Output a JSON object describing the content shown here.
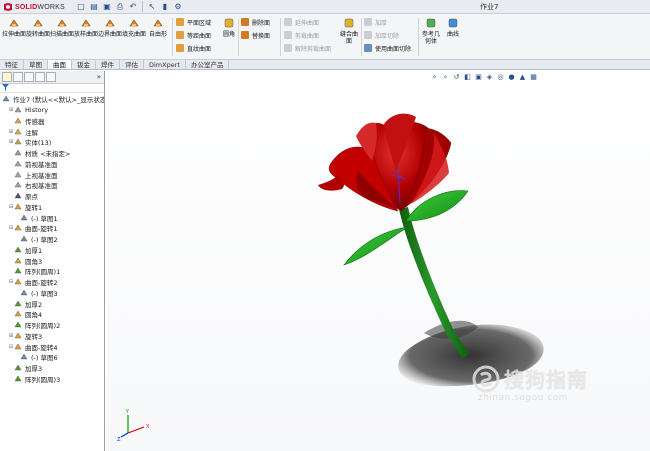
{
  "titlebar": {
    "brand_ds": "3S",
    "brand_name": "SOLID",
    "brand_name2": "WORKS",
    "document_title": "作业7"
  },
  "quick_access": [
    "new-icon",
    "open-icon",
    "save-icon",
    "print-icon",
    "undo-icon",
    "select-icon",
    "rebuild-icon",
    "options-icon"
  ],
  "ribbon": {
    "big_tools": [
      {
        "label": "拉伸曲面",
        "icon": "extrude-surface-icon",
        "color": "#d9822b"
      },
      {
        "label": "旋转曲面",
        "icon": "revolve-surface-icon",
        "color": "#d9822b"
      },
      {
        "label": "扫描曲面",
        "icon": "sweep-surface-icon",
        "color": "#d9822b"
      },
      {
        "label": "放样曲面",
        "icon": "loft-surface-icon",
        "color": "#d9822b"
      },
      {
        "label": "边界曲面",
        "icon": "boundary-surface-icon",
        "color": "#d9822b"
      },
      {
        "label": "填充曲面",
        "icon": "fill-surface-icon",
        "color": "#d9822b"
      },
      {
        "label": "自由形",
        "icon": "freeform-icon",
        "color": "#d9822b"
      }
    ],
    "col1": [
      {
        "label": "平面区域",
        "icon": "planar-surface-icon",
        "disabled": false
      },
      {
        "label": "等距曲面",
        "icon": "offset-surface-icon",
        "disabled": false
      },
      {
        "label": "直纹曲面",
        "icon": "ruled-surface-icon",
        "disabled": false
      }
    ],
    "fillet": {
      "label": "圆角",
      "icon": "fillet-icon"
    },
    "col2": [
      {
        "label": "删除面",
        "icon": "delete-face-icon",
        "disabled": false
      },
      {
        "label": "替换面",
        "icon": "replace-face-icon",
        "disabled": false
      }
    ],
    "col3": [
      {
        "label": "延伸曲面",
        "icon": "extend-surface-icon",
        "disabled": true
      },
      {
        "label": "剪裁曲面",
        "icon": "trim-surface-icon",
        "disabled": true
      },
      {
        "label": "解除剪裁曲面",
        "icon": "untrim-surface-icon",
        "disabled": true
      }
    ],
    "knit": {
      "label": "缝合曲面",
      "icon": "knit-surface-icon"
    },
    "col4": [
      {
        "label": "加厚",
        "icon": "thicken-icon",
        "disabled": true
      },
      {
        "label": "加厚切除",
        "icon": "thicken-cut-icon",
        "disabled": true
      },
      {
        "label": "使用曲面切除",
        "icon": "surface-cut-icon",
        "disabled": false
      }
    ],
    "ref_geometry": {
      "label": "参考几何体",
      "icon": "reference-geometry-icon"
    },
    "curves": {
      "label": "曲线",
      "icon": "curves-icon"
    }
  },
  "tabs": [
    {
      "label": "特征",
      "active": false
    },
    {
      "label": "草图",
      "active": false
    },
    {
      "label": "曲面",
      "active": true
    },
    {
      "label": "钣金",
      "active": false
    },
    {
      "label": "焊件",
      "active": false
    },
    {
      "label": "评估",
      "active": false
    },
    {
      "label": "DimXpert",
      "active": false
    },
    {
      "label": "办公室产品",
      "active": false
    }
  ],
  "feature_manager": {
    "collapse_label": "»",
    "filter_icon": "filter-icon",
    "tree": [
      {
        "label": "作业7 (默认<<默认>_显示状态",
        "indent": 0,
        "icon": "part-icon",
        "color": "#6f8fb8",
        "expand": ""
      },
      {
        "label": "History",
        "indent": 1,
        "icon": "history-icon",
        "color": "#a0a0a0",
        "expand": "+"
      },
      {
        "label": "传感器",
        "indent": 1,
        "icon": "sensor-icon",
        "color": "#d8b04a",
        "expand": ""
      },
      {
        "label": "注解",
        "indent": 1,
        "icon": "annotation-icon",
        "color": "#d8b04a",
        "expand": "+"
      },
      {
        "label": "实体(13)",
        "indent": 1,
        "icon": "solid-bodies-icon",
        "color": "#c9a14a",
        "expand": "+"
      },
      {
        "label": "材质 <未指定>",
        "indent": 1,
        "icon": "material-icon",
        "color": "#8ca0b4",
        "expand": ""
      },
      {
        "label": "前视基准面",
        "indent": 1,
        "icon": "plane-icon",
        "color": "#9aa7b5",
        "expand": ""
      },
      {
        "label": "上视基准面",
        "indent": 1,
        "icon": "plane-icon",
        "color": "#9aa7b5",
        "expand": ""
      },
      {
        "label": "右视基准面",
        "indent": 1,
        "icon": "plane-icon",
        "color": "#9aa7b5",
        "expand": ""
      },
      {
        "label": "原点",
        "indent": 1,
        "icon": "origin-icon",
        "color": "#555555",
        "expand": ""
      },
      {
        "label": "旋转1",
        "indent": 1,
        "icon": "revolve-icon",
        "color": "#d9a23a",
        "expand": "-"
      },
      {
        "label": "(-) 草图1",
        "indent": 2,
        "icon": "sketch-icon",
        "color": "#7a8a99",
        "expand": ""
      },
      {
        "label": "曲面-旋转1",
        "indent": 1,
        "icon": "surface-revolve-icon",
        "color": "#d9a23a",
        "expand": "-"
      },
      {
        "label": "(-) 草图2",
        "indent": 2,
        "icon": "sketch-icon",
        "color": "#7a8a99",
        "expand": ""
      },
      {
        "label": "加厚1",
        "indent": 1,
        "icon": "thicken-icon",
        "color": "#4f9b3a",
        "expand": ""
      },
      {
        "label": "圆角3",
        "indent": 1,
        "icon": "fillet-icon",
        "color": "#d9a23a",
        "expand": ""
      },
      {
        "label": "阵列(圆周)1",
        "indent": 1,
        "icon": "circular-pattern-icon",
        "color": "#4f9b3a",
        "expand": ""
      },
      {
        "label": "曲面-旋转2",
        "indent": 1,
        "icon": "surface-revolve-icon",
        "color": "#d9a23a",
        "expand": "-"
      },
      {
        "label": "(-) 草图3",
        "indent": 2,
        "icon": "sketch-icon",
        "color": "#7a8a99",
        "expand": ""
      },
      {
        "label": "加厚2",
        "indent": 1,
        "icon": "thicken-icon",
        "color": "#4f9b3a",
        "expand": ""
      },
      {
        "label": "圆角4",
        "indent": 1,
        "icon": "fillet-icon",
        "color": "#d9a23a",
        "expand": ""
      },
      {
        "label": "阵列(圆周)2",
        "indent": 1,
        "icon": "circular-pattern-icon",
        "color": "#4f9b3a",
        "expand": ""
      },
      {
        "label": "旋转3",
        "indent": 1,
        "icon": "revolve-icon",
        "color": "#d9a23a",
        "expand": "+"
      },
      {
        "label": "曲面-旋转4",
        "indent": 1,
        "icon": "surface-revolve-icon",
        "color": "#d9a23a",
        "expand": "-"
      },
      {
        "label": "(-) 草图6",
        "indent": 2,
        "icon": "sketch-icon",
        "color": "#7a8a99",
        "expand": ""
      },
      {
        "label": "加厚3",
        "indent": 1,
        "icon": "thicken-icon",
        "color": "#4f9b3a",
        "expand": ""
      },
      {
        "label": "阵列(圆周)3",
        "indent": 1,
        "icon": "circular-pattern-icon",
        "color": "#4f9b3a",
        "expand": ""
      }
    ]
  },
  "view_toolbar": [
    "zoom-to-fit-icon",
    "zoom-area-icon",
    "previous-view-icon",
    "section-view-icon",
    "view-orientation-icon",
    "display-style-icon",
    "hide-show-icon",
    "appearance-icon",
    "scene-icon",
    "view-settings-icon"
  ],
  "model": {
    "petal_color": "#b00000",
    "leaf_color": "#1fa01f",
    "stem_color": "#1a7a1a",
    "axis_x": "X",
    "axis_y": "Y",
    "axis_z": "Z"
  },
  "watermark": {
    "text": "搜狗指南",
    "url": "zhinan.sogou.com"
  }
}
